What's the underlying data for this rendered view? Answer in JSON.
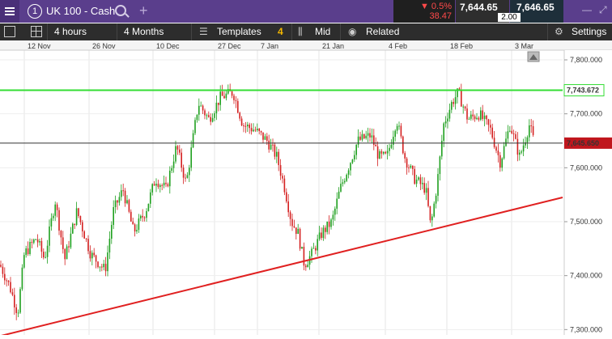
{
  "topbar": {
    "instrument_number": "1",
    "instrument": "UK 100 - Cash",
    "change_pct": "▼ 0.5%",
    "change_pts": "38.47",
    "sell_price": "7,644.65",
    "buy_price": "7,646.65",
    "spread": "2.00"
  },
  "toolbar": {
    "interval": "4 hours",
    "range": "4 Months",
    "templates_label": "Templates",
    "templates_count": "4",
    "price_type": "Mid",
    "related_label": "Related",
    "settings_label": "Settings"
  },
  "chart_data": {
    "type": "candlestick",
    "x_ticks": [
      "12 Nov",
      "26 Nov",
      "10 Dec",
      "27 Dec",
      "7 Jan",
      "21 Jan",
      "4 Feb",
      "18 Feb",
      "3 Mar"
    ],
    "y_ticks": [
      "7,800.000",
      "7,700.000",
      "7,600.000",
      "7,500.000",
      "7,400.000",
      "7,300.000"
    ],
    "ylim": [
      7290,
      7815
    ],
    "current_price_label": "7,645.650",
    "resistance_label": "7,743.672",
    "current_price": 7645.65,
    "resistance_level": 7743.672,
    "trendline": {
      "start": 7288,
      "end": 7545
    },
    "up_color": "#1fa01f",
    "down_color": "#d42020",
    "resistance_color": "#33dd33",
    "trendline_color": "#e02020",
    "current_price_color": "#c0161d",
    "path": [
      [
        0,
        7420
      ],
      [
        12,
        7380
      ],
      [
        22,
        7330
      ],
      [
        30,
        7440
      ],
      [
        45,
        7470
      ],
      [
        55,
        7430
      ],
      [
        68,
        7540
      ],
      [
        80,
        7430
      ],
      [
        95,
        7520
      ],
      [
        112,
        7440
      ],
      [
        130,
        7410
      ],
      [
        140,
        7520
      ],
      [
        152,
        7560
      ],
      [
        165,
        7480
      ],
      [
        180,
        7520
      ],
      [
        192,
        7580
      ],
      [
        205,
        7560
      ],
      [
        218,
        7640
      ],
      [
        230,
        7570
      ],
      [
        245,
        7720
      ],
      [
        258,
        7690
      ],
      [
        272,
        7730
      ],
      [
        288,
        7740
      ],
      [
        300,
        7680
      ],
      [
        315,
        7670
      ],
      [
        330,
        7650
      ],
      [
        342,
        7620
      ],
      [
        352,
        7560
      ],
      [
        360,
        7500
      ],
      [
        368,
        7480
      ],
      [
        376,
        7420
      ],
      [
        385,
        7440
      ],
      [
        398,
        7480
      ],
      [
        410,
        7500
      ],
      [
        420,
        7560
      ],
      [
        430,
        7600
      ],
      [
        442,
        7650
      ],
      [
        458,
        7660
      ],
      [
        468,
        7620
      ],
      [
        478,
        7620
      ],
      [
        490,
        7690
      ],
      [
        500,
        7620
      ],
      [
        512,
        7580
      ],
      [
        526,
        7560
      ],
      [
        532,
        7490
      ],
      [
        540,
        7570
      ],
      [
        548,
        7680
      ],
      [
        558,
        7720
      ],
      [
        566,
        7740
      ],
      [
        578,
        7690
      ],
      [
        592,
        7700
      ],
      [
        606,
        7670
      ],
      [
        618,
        7610
      ],
      [
        630,
        7680
      ],
      [
        642,
        7620
      ],
      [
        654,
        7680
      ],
      [
        660,
        7646
      ]
    ]
  }
}
